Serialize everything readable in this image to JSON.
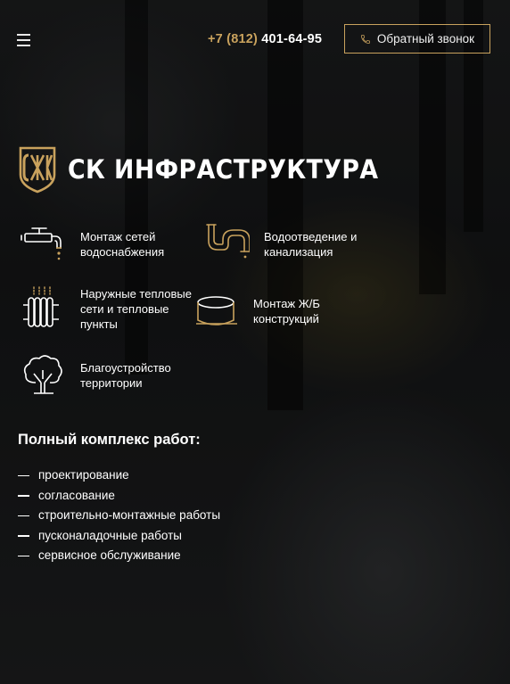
{
  "header": {
    "menu_icon": "hamburger-menu-icon",
    "phone_code": "+7 (812)",
    "phone_number": "401-64-95",
    "callback_label": "Обратный звонок",
    "callback_icon": "phone-icon"
  },
  "brand": {
    "name": "СК ИНФРАСТРУКТУРА",
    "logo_icon": "ski-monogram-logo"
  },
  "services": [
    {
      "label": "Монтаж сетей водоснабжения",
      "icon": "faucet-icon"
    },
    {
      "label": "Водоотведение и канализация",
      "icon": "drain-pipe-icon"
    },
    {
      "label": "Наружные тепловые сети и тепловые пункты",
      "icon": "radiator-icon"
    },
    {
      "label": "Монтаж Ж/Б конструкций",
      "icon": "concrete-ring-icon"
    },
    {
      "label": "Благоустройство территории",
      "icon": "tree-icon"
    }
  ],
  "works": {
    "title": "Полный комплекс работ:",
    "items": [
      "проектирование",
      "согласование",
      "строительно-монтажные работы",
      "пусконаладочные работы",
      "сервисное обслуживание"
    ]
  },
  "colors": {
    "accent": "#c9a25d",
    "text": "#ffffff",
    "background": "#141516"
  }
}
